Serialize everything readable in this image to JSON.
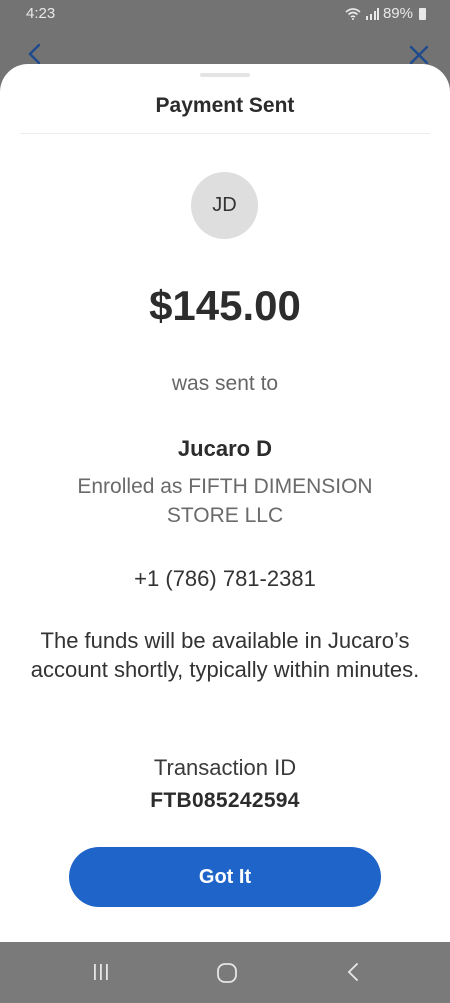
{
  "status_bar": {
    "time": "4:23",
    "battery": "89%"
  },
  "sheet": {
    "title": "Payment Sent",
    "avatar_initials": "JD",
    "amount": "$145.00",
    "sent_to_label": "was sent to",
    "recipient_name": "Jucaro D",
    "enrolled_as": "Enrolled as FIFTH DIMENSION STORE LLC",
    "phone": "+1 (786) 781-2381",
    "funds_note": "The funds will be available in Jucaro’s account shortly, typically within minutes.",
    "transaction_label": "Transaction ID",
    "transaction_id": "FTB085242594",
    "button_label": "Got It"
  },
  "colors": {
    "primary": "#1f64c8",
    "overlay": "#737373",
    "sheet": "#ffffff"
  },
  "icons": {
    "background_back": "chevron-left-icon",
    "background_close": "close-icon",
    "nav_recent": "recent-apps-icon",
    "nav_home": "home-icon",
    "nav_back": "back-icon"
  }
}
